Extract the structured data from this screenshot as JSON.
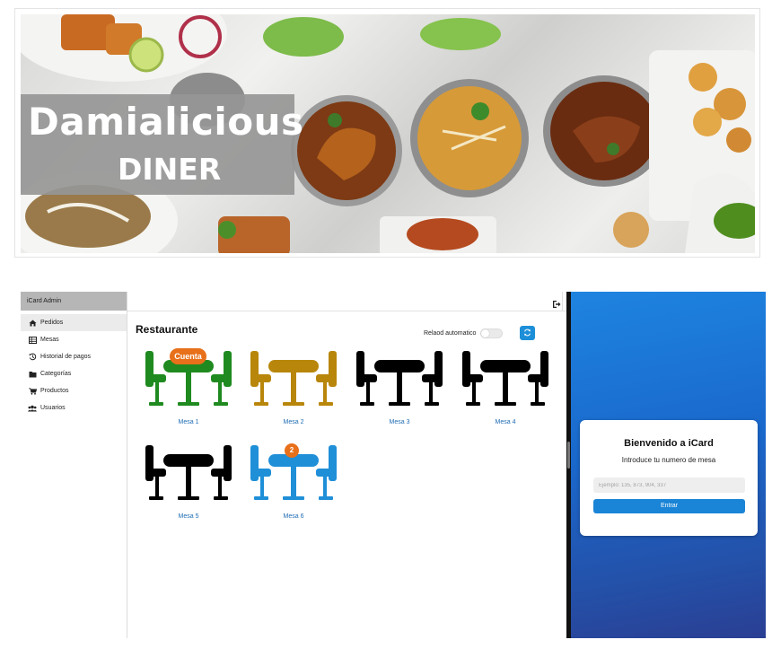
{
  "banner": {
    "brand_name": "Damialicious",
    "brand_sub": "DINER"
  },
  "admin": {
    "app_name": "iCard Admin",
    "menu": [
      {
        "label": "Pedidos",
        "icon": "home-icon",
        "active": true
      },
      {
        "label": "Mesas",
        "icon": "table-icon",
        "active": false
      },
      {
        "label": "Historial de pagos",
        "icon": "history-icon",
        "active": false
      },
      {
        "label": "Categorías",
        "icon": "folder-icon",
        "active": false
      },
      {
        "label": "Productos",
        "icon": "cart-icon",
        "active": false
      },
      {
        "label": "Usuarios",
        "icon": "users-icon",
        "active": false
      }
    ],
    "page_title": "Restaurante",
    "reload_label": "Relaod automatico",
    "reload_enabled": false,
    "tables": [
      {
        "label": "Mesa 1",
        "color": "#1f8a1f",
        "badge": "Cuenta"
      },
      {
        "label": "Mesa 2",
        "color": "#b8860b",
        "badge": ""
      },
      {
        "label": "Mesa 3",
        "color": "#000000",
        "badge": ""
      },
      {
        "label": "Mesa 4",
        "color": "#000000",
        "badge": ""
      },
      {
        "label": "Mesa 5",
        "color": "#000000",
        "badge": ""
      },
      {
        "label": "Mesa 6",
        "color": "#1f8fd8",
        "badge": "2"
      }
    ]
  },
  "client": {
    "welcome": "Bienvenido a iCard",
    "instruction": "Introduce tu numero de mesa",
    "input_placeholder": "Ejemplo: 135, 873, 904, 337",
    "enter_label": "Entrar"
  },
  "colors": {
    "accent": "#1c8fd8",
    "badge": "#e8701a",
    "link": "#1f6cb4"
  }
}
